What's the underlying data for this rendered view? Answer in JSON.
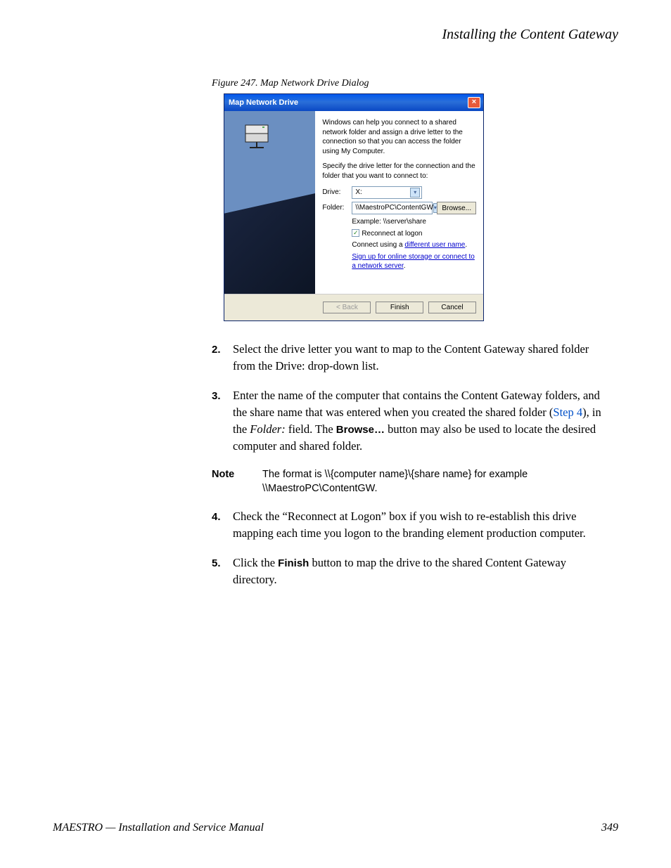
{
  "header": {
    "section_title": "Installing the Content Gateway"
  },
  "figure": {
    "caption": "Figure 247.  Map Network Drive Dialog"
  },
  "dialog": {
    "title": "Map Network Drive",
    "close": "×",
    "p1": "Windows can help you connect to a shared network folder and assign a drive letter to the connection so that you can access the folder using My Computer.",
    "p2": "Specify the drive letter for the connection and the folder that you want to connect to:",
    "drive_label": "Drive:",
    "drive_value": "X:",
    "folder_label": "Folder:",
    "folder_value": "\\\\MaestroPC\\ContentGW",
    "browse": "Browse...",
    "example": "Example: \\\\server\\share",
    "reconnect": "Reconnect at logon",
    "connect_using_pre": "Connect using a ",
    "connect_using_link": "different user name",
    "signup_link": "Sign up for online storage or connect to a network server",
    "back": "< Back",
    "finish": "Finish",
    "cancel": "Cancel"
  },
  "steps": {
    "s2_num": "2.",
    "s2_text": "Select the drive letter you want to map to the Content Gateway shared folder from the Drive: drop-down list.",
    "s3_num": "3.",
    "s3_pre": "Enter the name of the computer that contains the Content Gateway folders, and the share name that was entered when you created the shared folder (",
    "s3_link": "Step 4",
    "s3_mid1": "), in the ",
    "s3_ital": "Folder:",
    "s3_mid2": " field. The ",
    "s3_bold": "Browse…",
    "s3_post": " button may also be used to locate the desired computer and shared folder.",
    "note_label": "Note",
    "note_text": "The format is \\\\{computer name}\\{share name} for example \\\\MaestroPC\\ContentGW.",
    "s4_num": "4.",
    "s4_text": "Check the “Reconnect at Logon” box if you wish to re-establish this drive mapping each time you logon to the branding element production computer.",
    "s5_num": "5.",
    "s5_pre": "Click the ",
    "s5_bold": "Finish",
    "s5_post": " button to map the drive to the shared Content Gateway directory."
  },
  "footer": {
    "left": "MAESTRO  —  Installation and Service Manual",
    "page": "349"
  }
}
